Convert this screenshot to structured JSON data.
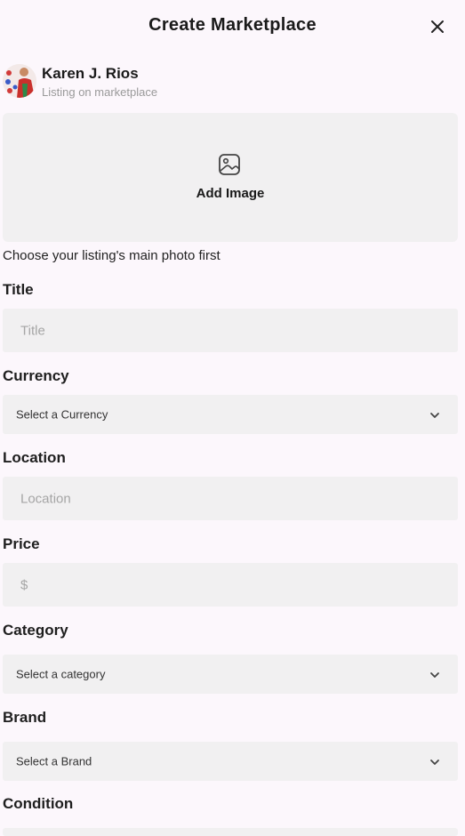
{
  "header": {
    "title": "Create Marketplace",
    "close_icon": "close-icon"
  },
  "user": {
    "name": "Karen J. Rios",
    "subtitle": "Listing on marketplace",
    "avatar": "avatar-photo"
  },
  "image_upload": {
    "label": "Add Image",
    "icon": "image-icon"
  },
  "hint": "Choose your listing's main photo first",
  "fields": {
    "title": {
      "label": "Title",
      "placeholder": "Title"
    },
    "currency": {
      "label": "Currency",
      "value": "Select a Currency"
    },
    "location": {
      "label": "Location",
      "placeholder": "Location"
    },
    "price": {
      "label": "Price",
      "placeholder": "$"
    },
    "category": {
      "label": "Category",
      "value": "Select a category"
    },
    "brand": {
      "label": "Brand",
      "value": "Select a Brand"
    },
    "condition": {
      "label": "Condition"
    }
  },
  "colors": {
    "background": "#fcf7fc",
    "field": "#f1f0f1",
    "placeholder": "#a5a5a5",
    "subtext": "#9a9a9a"
  }
}
